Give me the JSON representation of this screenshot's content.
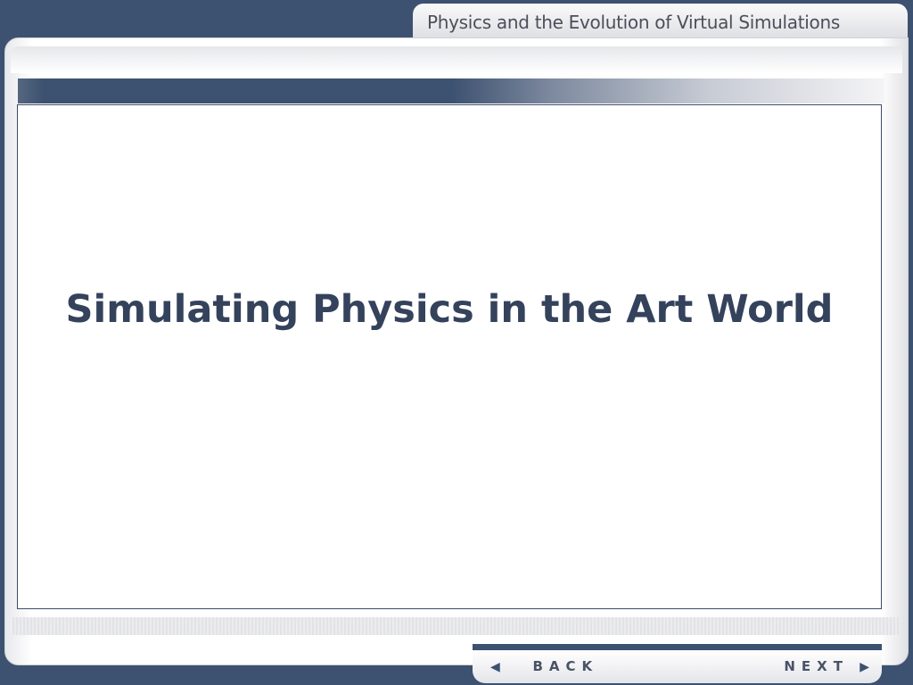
{
  "header": {
    "course_title": "Physics and the Evolution of Virtual Simulations"
  },
  "main": {
    "slide_title": "Simulating Physics in the Art World"
  },
  "nav": {
    "back_label": "BACK",
    "next_label": "NEXT"
  }
}
